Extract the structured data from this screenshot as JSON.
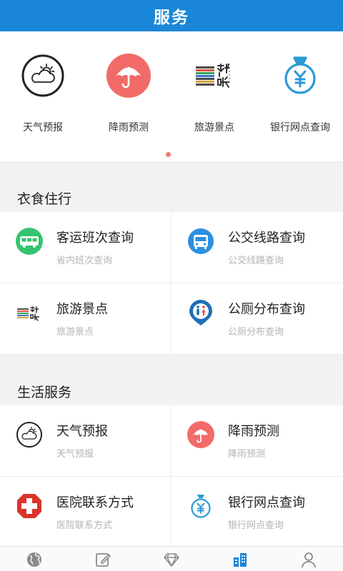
{
  "header": {
    "title": "服务"
  },
  "quick": [
    {
      "label": "天气预报",
      "icon": "weather-icon"
    },
    {
      "label": "降雨预测",
      "icon": "umbrella-icon"
    },
    {
      "label": "旅游景点",
      "icon": "scenic-spot-icon"
    },
    {
      "label": "银行网点查询",
      "icon": "money-bag-icon"
    }
  ],
  "sections": [
    {
      "title": "衣食住行",
      "items": [
        {
          "title": "客运班次查询",
          "subtitle": "省内班次查询",
          "icon": "coach-bus-icon"
        },
        {
          "title": "公交线路查询",
          "subtitle": "公交线路查询",
          "icon": "city-bus-icon"
        },
        {
          "title": "旅游景点",
          "subtitle": "旅游景点",
          "icon": "scenic-spot-icon"
        },
        {
          "title": "公厕分布查询",
          "subtitle": "公厕分布查询",
          "icon": "toilet-location-icon"
        }
      ]
    },
    {
      "title": "生活服务",
      "items": [
        {
          "title": "天气预报",
          "subtitle": "天气预报",
          "icon": "weather-icon"
        },
        {
          "title": "降雨预测",
          "subtitle": "降雨预测",
          "icon": "umbrella-icon"
        },
        {
          "title": "医院联系方式",
          "subtitle": "医院联系方式",
          "icon": "hospital-cross-icon"
        },
        {
          "title": "银行网点查询",
          "subtitle": "银行网点查询",
          "icon": "money-bag-icon"
        }
      ]
    }
  ],
  "tabs": [
    {
      "icon": "globe-icon",
      "active": false
    },
    {
      "icon": "edit-icon",
      "active": false
    },
    {
      "icon": "diamond-icon",
      "active": false
    },
    {
      "icon": "buildings-icon",
      "active": true
    },
    {
      "icon": "person-icon",
      "active": false
    }
  ],
  "colors": {
    "header": "#1a86d8",
    "tab_active": "#1a86d8",
    "pager_dot": "#f07e6e"
  }
}
